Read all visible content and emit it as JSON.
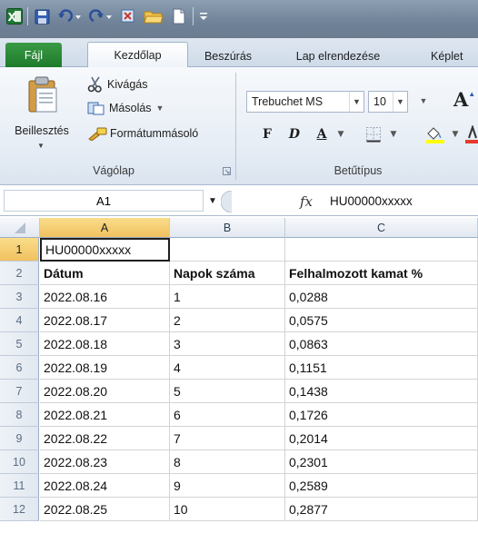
{
  "app": {
    "brand_color": "#1d7b2b"
  },
  "ribbon_tabs": [
    {
      "id": "file",
      "label": "Fájl"
    },
    {
      "id": "home",
      "label": "Kezdőlap"
    },
    {
      "id": "insert",
      "label": "Beszúrás"
    },
    {
      "id": "layout",
      "label": "Lap elrendezése"
    },
    {
      "id": "formulas",
      "label": "Képlet"
    }
  ],
  "clipboard": {
    "paste_label": "Beillesztés",
    "cut_label": "Kivágás",
    "copy_label": "Másolás",
    "format_painter_label": "Formátummásoló",
    "group_label": "Vágólap"
  },
  "font": {
    "font_name": "Trebuchet MS",
    "font_size": "10",
    "bold": "F",
    "italic": "D",
    "underline": "A",
    "group_label": "Betűtípus"
  },
  "formula_bar": {
    "name_box": "A1",
    "fx_label": "fx",
    "value": "HU00000xxxxx"
  },
  "sheet": {
    "columns": [
      "A",
      "B",
      "C"
    ],
    "rows": [
      {
        "num": "1",
        "cells": [
          "HU00000xxxxx",
          "",
          ""
        ]
      },
      {
        "num": "2",
        "cells": [
          "Dátum",
          "Napok száma",
          "Felhalmozott kamat %"
        ]
      },
      {
        "num": "3",
        "cells": [
          "2022.08.16",
          "1",
          "0,0288"
        ]
      },
      {
        "num": "4",
        "cells": [
          "2022.08.17",
          "2",
          "0,0575"
        ]
      },
      {
        "num": "5",
        "cells": [
          "2022.08.18",
          "3",
          "0,0863"
        ]
      },
      {
        "num": "6",
        "cells": [
          "2022.08.19",
          "4",
          "0,1151"
        ]
      },
      {
        "num": "7",
        "cells": [
          "2022.08.20",
          "5",
          "0,1438"
        ]
      },
      {
        "num": "8",
        "cells": [
          "2022.08.21",
          "6",
          "0,1726"
        ]
      },
      {
        "num": "9",
        "cells": [
          "2022.08.22",
          "7",
          "0,2014"
        ]
      },
      {
        "num": "10",
        "cells": [
          "2022.08.23",
          "8",
          "0,2301"
        ]
      },
      {
        "num": "11",
        "cells": [
          "2022.08.24",
          "9",
          "0,2589"
        ]
      },
      {
        "num": "12",
        "cells": [
          "2022.08.25",
          "10",
          "0,2877"
        ]
      }
    ]
  }
}
